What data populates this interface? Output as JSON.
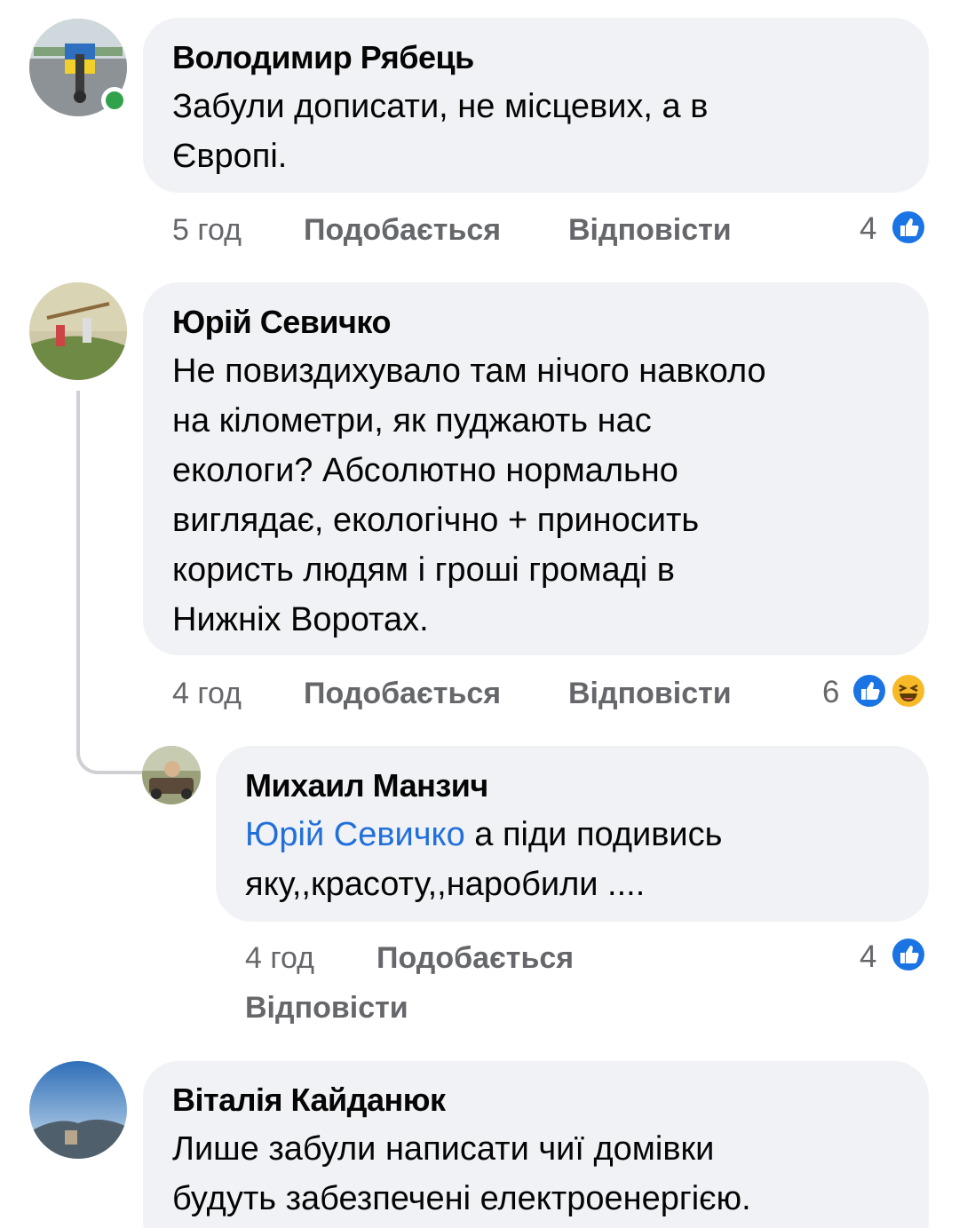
{
  "comments": [
    {
      "author": "Володимир Рябець",
      "lines": [
        "Забули дописати, не місцевих, а в",
        "Європі."
      ],
      "time": "5 год",
      "like_label": "Подобається",
      "reply_label": "Відповісти",
      "reaction_count": "4",
      "reactions": [
        "like-icon"
      ],
      "online": true
    },
    {
      "author": "Юрій Севичко",
      "lines": [
        "Не повиздихувало там нічого навколо",
        "на кілометри, як пуджають нас",
        "екологи? Абсолютно нормально",
        "виглядає, екологічно + приносить",
        "користь людям і гроші  громаді в",
        "Нижніх Воротах."
      ],
      "time": "4 год",
      "like_label": "Подобається",
      "reply_label": "Відповісти",
      "reaction_count": "6",
      "reactions": [
        "like-icon",
        "haha-icon"
      ]
    },
    {
      "author": "Михаил Манзич",
      "mention": "Юрій Севичко",
      "line1_rest": " а піди подивись",
      "line2": "яку,,красоту,,наробили ....",
      "time": "4 год",
      "like_label": "Подобається",
      "reply_label": "Відповісти",
      "reaction_count": "4",
      "reactions": [
        "like-icon"
      ]
    },
    {
      "author": "Віталія Кайданюк",
      "lines": [
        "Лише забули написати чиї домівки",
        "будуть забезпечені електроенергією."
      ]
    }
  ],
  "colors": {
    "bubble": "#f0f2f5",
    "meta": "#65676b",
    "mention": "#216fdb",
    "like": "#1b74e4",
    "online": "#31a24c"
  }
}
